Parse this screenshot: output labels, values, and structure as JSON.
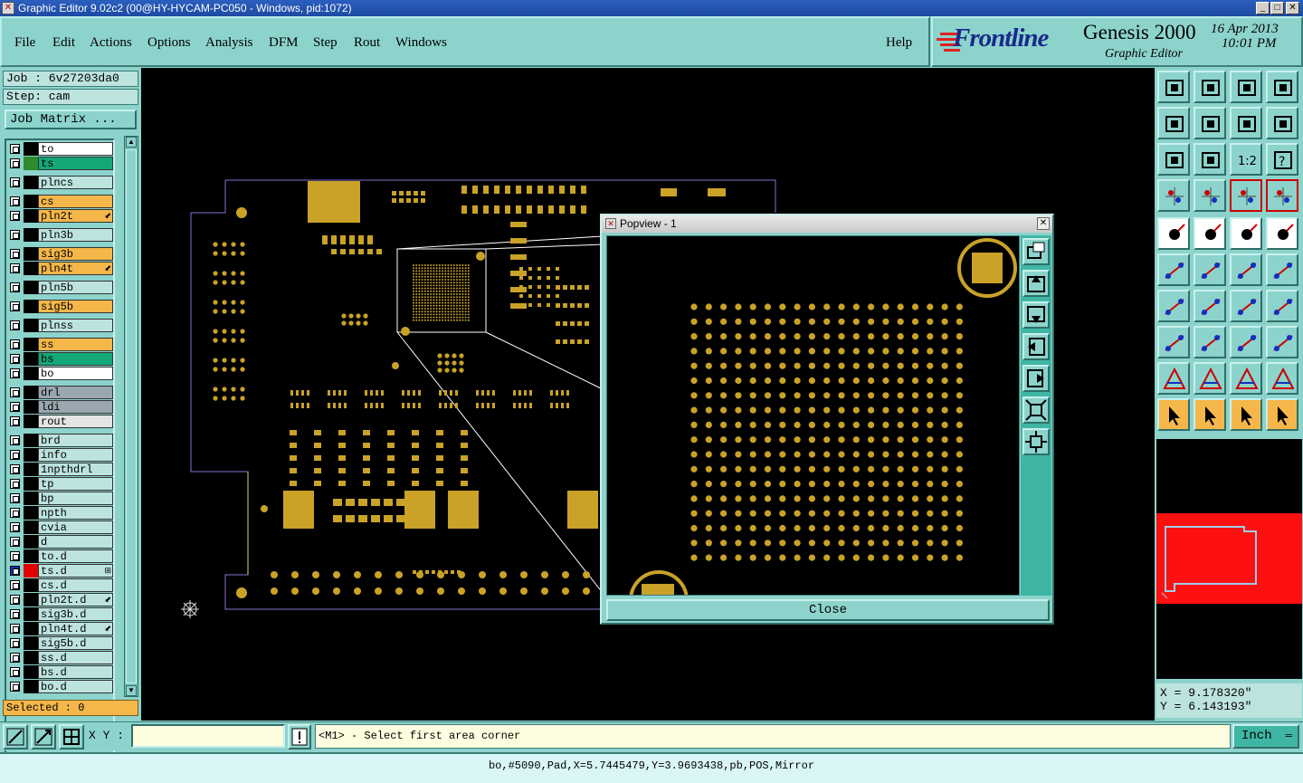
{
  "window": {
    "title": "Graphic Editor 9.02c2 (00@HY-HYCAM-PC050 - Windows, pid:1072)",
    "min": "_",
    "max": "□",
    "close": "✕"
  },
  "menu": {
    "items": [
      "File",
      "Edit",
      "Actions",
      "Options",
      "Analysis",
      "DFM",
      "Step",
      "Rout",
      "Windows"
    ],
    "help": "Help"
  },
  "brand": {
    "logo": "Frontline",
    "product": "Genesis 2000",
    "subtitle": "Graphic Editor",
    "date": "16 Apr 2013",
    "time": "10:01 PM"
  },
  "left": {
    "job": "Job : 6v27203da0",
    "step": "Step: cam",
    "job_matrix": "Job Matrix ...",
    "selected": "Selected : 0",
    "layers": [
      {
        "name": "to",
        "bg": "#ffffff",
        "sw": "#000000"
      },
      {
        "name": "ts",
        "bg": "#14a878",
        "sw": "#2e8b2e"
      },
      {
        "name": "plncs",
        "bg": "#bde3df",
        "sw": "#000000",
        "gap": true
      },
      {
        "name": "cs",
        "bg": "#f5b74a",
        "sw": "#000000",
        "gap": true
      },
      {
        "name": "pln2t",
        "bg": "#f5b74a",
        "sw": "#000000",
        "mark": "⬋"
      },
      {
        "name": "pln3b",
        "bg": "#bde3df",
        "sw": "#000000",
        "gap": true
      },
      {
        "name": "sig3b",
        "bg": "#f5b74a",
        "sw": "#000000",
        "gap": true
      },
      {
        "name": "pln4t",
        "bg": "#f5b74a",
        "sw": "#000000",
        "mark": "⬋"
      },
      {
        "name": "pln5b",
        "bg": "#bde3df",
        "sw": "#000000",
        "gap": true
      },
      {
        "name": "sig5b",
        "bg": "#f5b74a",
        "sw": "#000000",
        "gap": true
      },
      {
        "name": "plnss",
        "bg": "#bde3df",
        "sw": "#000000",
        "gap": true
      },
      {
        "name": "ss",
        "bg": "#f5b74a",
        "sw": "#000000",
        "gap": true
      },
      {
        "name": "bs",
        "bg": "#14a878",
        "sw": "#000000"
      },
      {
        "name": "bo",
        "bg": "#ffffff",
        "sw": "#000000"
      },
      {
        "name": "drl",
        "bg": "#9aa6b0",
        "sw": "#000000",
        "gap": true
      },
      {
        "name": "ldi",
        "bg": "#9aa6b0",
        "sw": "#000000"
      },
      {
        "name": "rout",
        "bg": "#e4e4e4",
        "sw": "#000000"
      },
      {
        "name": "brd",
        "bg": "#bde3df",
        "sw": "#000000",
        "gap": true
      },
      {
        "name": "info",
        "bg": "#bde3df",
        "sw": "#000000"
      },
      {
        "name": "1npthdrl",
        "bg": "#bde3df",
        "sw": "#000000"
      },
      {
        "name": "tp",
        "bg": "#bde3df",
        "sw": "#000000"
      },
      {
        "name": "bp",
        "bg": "#bde3df",
        "sw": "#000000"
      },
      {
        "name": "npth",
        "bg": "#bde3df",
        "sw": "#000000"
      },
      {
        "name": "cvia",
        "bg": "#bde3df",
        "sw": "#000000"
      },
      {
        "name": "d",
        "bg": "#bde3df",
        "sw": "#000000"
      },
      {
        "name": "to.d",
        "bg": "#bde3df",
        "sw": "#000000"
      },
      {
        "name": "ts.d",
        "bg": "#bde3df",
        "sw": "#e00000",
        "active": true,
        "mark": "⊞"
      },
      {
        "name": "cs.d",
        "bg": "#bde3df",
        "sw": "#000000"
      },
      {
        "name": "pln2t.d",
        "bg": "#bde3df",
        "sw": "#000000",
        "mark": "⬋"
      },
      {
        "name": "sig3b.d",
        "bg": "#bde3df",
        "sw": "#000000"
      },
      {
        "name": "pln4t.d",
        "bg": "#bde3df",
        "sw": "#000000",
        "mark": "⬋"
      },
      {
        "name": "sig5b.d",
        "bg": "#bde3df",
        "sw": "#000000"
      },
      {
        "name": "ss.d",
        "bg": "#bde3df",
        "sw": "#000000"
      },
      {
        "name": "bs.d",
        "bg": "#bde3df",
        "sw": "#000000"
      },
      {
        "name": "bo.d",
        "bg": "#bde3df",
        "sw": "#000000"
      }
    ]
  },
  "popview": {
    "title": "Popview - 1",
    "close_label": "Close"
  },
  "coords": {
    "x": "X = 9.178320\"",
    "y": "Y = 6.143193\""
  },
  "bottom": {
    "xy_label": "X Y :",
    "xy_value": "",
    "prompt": "<M1> - Select first area corner",
    "units": "Inch"
  },
  "status": {
    "text": "bo,#5090,Pad,X=5.7445479,Y=3.9693438,pb,POS,Mirror"
  },
  "colors": {
    "pad": "#c9a227",
    "board_outline": "#8a6fd1",
    "panel": "#8cd3cc",
    "highlight": "#f5b74a",
    "minimap_red": "#ff1010"
  }
}
